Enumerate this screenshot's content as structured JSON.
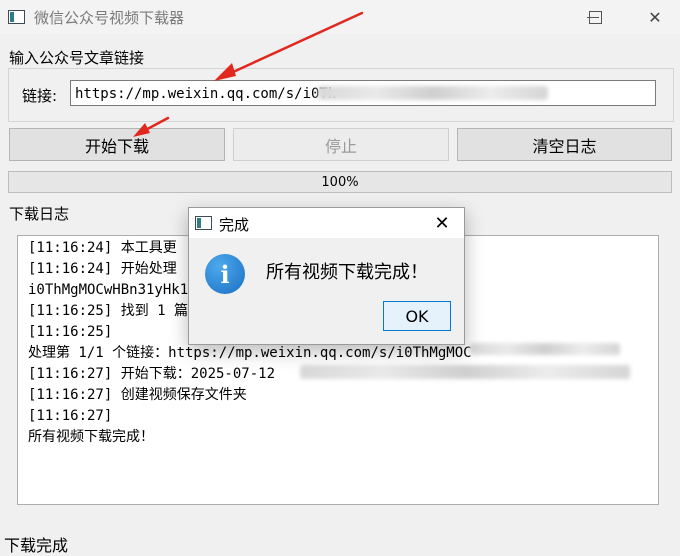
{
  "window": {
    "title": "微信公众号视频下载器"
  },
  "group": {
    "label": "输入公众号文章链接",
    "link_label": "链接:",
    "link_value": "https://mp.weixin.qq.com/s/i0Th"
  },
  "buttons": {
    "start": "开始下载",
    "stop": "停止",
    "clear": "清空日志"
  },
  "progress": {
    "value": 1.0,
    "text": "100%"
  },
  "log": {
    "label": "下载日志",
    "lines": [
      "[11:16:24] 本工具更",
      "[11:16:24] 开始处理",
      "i0ThMgMOCwHBn31yHk1",
      "[11:16:25] 找到 1 篇",
      "[11:16:25]",
      "处理第 1/1 个链接：https://mp.weixin.qq.com/s/i0ThMgMOC",
      "[11:16:27] 开始下载：2025-07-12",
      "[11:16:27] 创建视频保存文件夹",
      "[11:16:27]",
      "所有视频下载完成！"
    ]
  },
  "status": "下载完成",
  "dialog": {
    "title": "完成",
    "message": "所有视频下载完成！",
    "ok": "OK",
    "icon_letter": "i"
  },
  "colors": {
    "arrow": "#e0281e",
    "info_icon": "#1a6fc4",
    "ok_border": "#0078d7"
  }
}
